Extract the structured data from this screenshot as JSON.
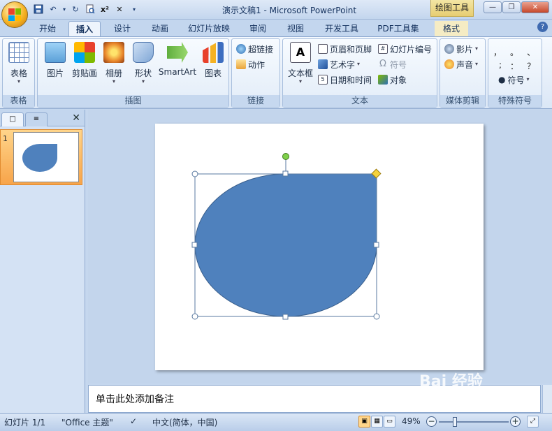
{
  "window": {
    "title": "演示文稿1 - Microsoft PowerPoint",
    "context_tab": "绘图工具",
    "buttons": {
      "minimize": "—",
      "restore": "❐",
      "close": "✕"
    }
  },
  "qat": {
    "save": "💾",
    "undo": "↶",
    "redo": "↻",
    "preview": "🔍",
    "superscript": "x²",
    "clear": "✕",
    "more": "▾"
  },
  "tabs": [
    "开始",
    "插入",
    "设计",
    "动画",
    "幻灯片放映",
    "审阅",
    "视图",
    "开发工具",
    "PDF工具集",
    "格式"
  ],
  "active_tab": "插入",
  "help": "?",
  "ribbon": {
    "groups": {
      "table": {
        "label": "表格",
        "buttons": [
          {
            "label": "表格",
            "icon": "table-icon"
          }
        ]
      },
      "illustrations": {
        "label": "插图",
        "buttons": [
          {
            "label": "图片",
            "icon": "picture-icon"
          },
          {
            "label": "剪贴画",
            "icon": "clipart-icon"
          },
          {
            "label": "相册",
            "icon": "album-icon"
          },
          {
            "label": "形状",
            "icon": "shapes-icon"
          },
          {
            "label": "SmartArt",
            "icon": "smartart-icon"
          },
          {
            "label": "图表",
            "icon": "chart-icon"
          }
        ]
      },
      "links": {
        "label": "链接",
        "buttons": [
          {
            "label": "超链接",
            "icon": "hyperlink-icon"
          },
          {
            "label": "动作",
            "icon": "action-icon"
          }
        ]
      },
      "text": {
        "label": "文本",
        "textbox": "文本框",
        "buttons": [
          {
            "label": "页眉和页脚",
            "icon": "header-footer-icon"
          },
          {
            "label": "艺术字",
            "icon": "wordart-icon"
          },
          {
            "label": "日期和时间",
            "icon": "datetime-icon"
          },
          {
            "label": "幻灯片编号",
            "icon": "slide-number-icon"
          },
          {
            "label": "符号",
            "icon": "omega-icon"
          },
          {
            "label": "对象",
            "icon": "object-icon"
          }
        ]
      },
      "media": {
        "label": "媒体剪辑",
        "buttons": [
          {
            "label": "影片",
            "icon": "movie-icon"
          },
          {
            "label": "声音",
            "icon": "sound-icon"
          }
        ]
      },
      "symbols": {
        "label": "特殊符号",
        "chars": [
          "，",
          "。",
          "、",
          ";",
          "：",
          "？"
        ],
        "symbol_button": "符号"
      }
    }
  },
  "slides_pane": {
    "tab1": "□",
    "tab2": "≡",
    "close": "✕",
    "thumbnail_number": "1"
  },
  "notes": {
    "placeholder": "单击此处添加备注"
  },
  "status": {
    "slide": "幻灯片 1/1",
    "theme": "\"Office 主题\"",
    "language": "中文(简体，中国)",
    "zoom": "49%"
  },
  "watermark": "Bai 经验",
  "colors": {
    "shape_fill": "#4f81bd",
    "shape_border": "#385d8a",
    "handle_yellow": "#f5d23d",
    "handle_green": "#7fd04a",
    "selection": "#5a7aa0"
  }
}
